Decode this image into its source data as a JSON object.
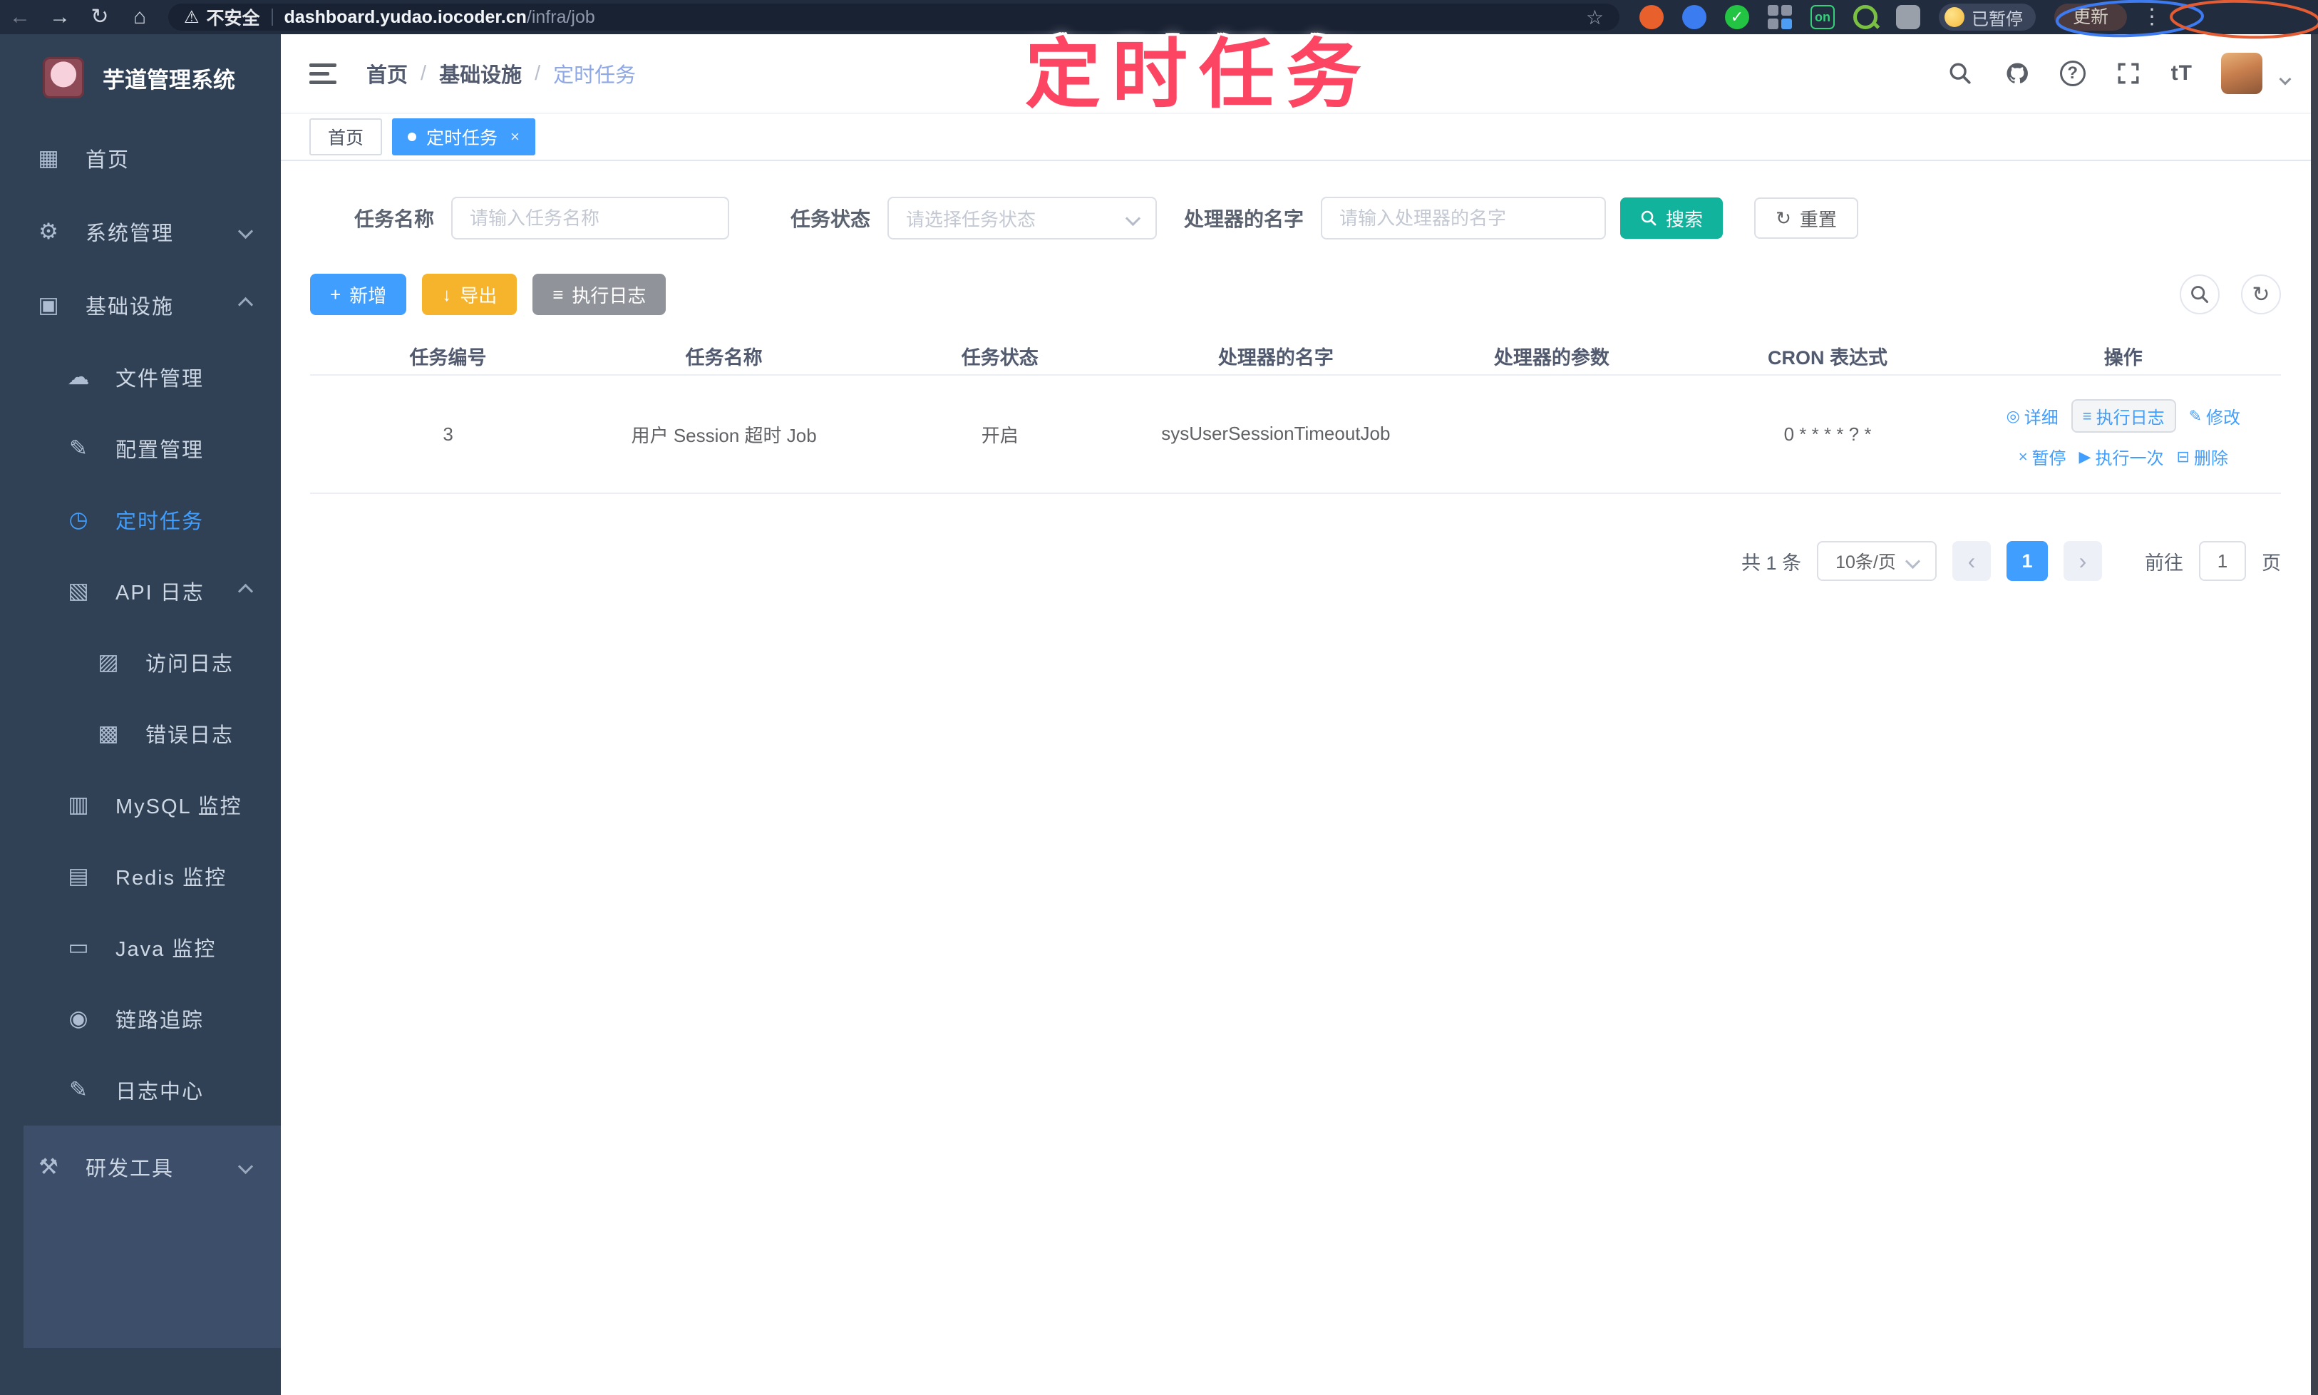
{
  "overlay": {
    "title": "定时任务"
  },
  "browser": {
    "back": "←",
    "forward": "→",
    "reload": "↻",
    "home": "⌂",
    "warn_icon": "⚠",
    "security_label": "不安全",
    "url_domain": "dashboard.yudao.iocoder.cn",
    "url_path": "/infra/job",
    "star": "☆",
    "ext_on_badge": "on",
    "paused_badge": "已暂停",
    "update_label": "更新",
    "menu_dots": "⋮"
  },
  "sidebar": {
    "app_title": "芋道管理系统",
    "items": [
      {
        "label": "首页",
        "glyph": "▦"
      },
      {
        "label": "系统管理",
        "glyph": "⚙"
      },
      {
        "label": "基础设施",
        "glyph": "▣"
      },
      {
        "label": "文件管理",
        "glyph": "☁"
      },
      {
        "label": "配置管理",
        "glyph": "✎"
      },
      {
        "label": "定时任务",
        "glyph": "◷"
      },
      {
        "label": "API 日志",
        "glyph": "▧"
      },
      {
        "label": "访问日志",
        "glyph": "▨"
      },
      {
        "label": "错误日志",
        "glyph": "▩"
      },
      {
        "label": "MySQL 监控",
        "glyph": "▥"
      },
      {
        "label": "Redis 监控",
        "glyph": "▤"
      },
      {
        "label": "Java 监控",
        "glyph": "▭"
      },
      {
        "label": "链路追踪",
        "glyph": "◉"
      },
      {
        "label": "日志中心",
        "glyph": "✎"
      },
      {
        "label": "研发工具",
        "glyph": "⚒"
      }
    ]
  },
  "breadcrumb": {
    "items": [
      "首页",
      "基础设施",
      "定时任务"
    ],
    "separator": "/"
  },
  "header": {
    "font_size_icon": "tT"
  },
  "tabs": [
    {
      "label": "首页"
    },
    {
      "label": "定时任务",
      "close": "×"
    }
  ],
  "filters": {
    "name_label": "任务名称",
    "name_placeholder": "请输入任务名称",
    "status_label": "任务状态",
    "status_placeholder": "请选择任务状态",
    "handler_label": "处理器的名字",
    "handler_placeholder": "请输入处理器的名字",
    "search_label": "搜索",
    "reset_label": "重置",
    "reset_icon": "↻"
  },
  "toolbar": {
    "add_label": "新增",
    "add_icon": "+",
    "export_label": "导出",
    "export_icon": "↓",
    "log_label": "执行日志",
    "log_icon": "≡",
    "refresh_icon": "↻"
  },
  "table": {
    "columns": [
      "任务编号",
      "任务名称",
      "任务状态",
      "处理器的名字",
      "处理器的参数",
      "CRON 表达式",
      "操作"
    ],
    "rows": [
      {
        "id": "3",
        "name": "用户 Session 超时 Job",
        "status": "开启",
        "handler": "sysUserSessionTimeoutJob",
        "param": "",
        "cron": "0 * * * * ? *"
      }
    ],
    "row_actions": [
      {
        "glyph": "◎",
        "label": "详细"
      },
      {
        "glyph": "≡",
        "label": "执行日志"
      },
      {
        "glyph": "✎",
        "label": "修改"
      },
      {
        "glyph": "×",
        "label": "暂停"
      },
      {
        "glyph": "▶",
        "label": "执行一次"
      },
      {
        "glyph": "⊟",
        "label": "删除"
      }
    ]
  },
  "pagination": {
    "total_label": "共 1 条",
    "page_size": "10条/页",
    "prev": "‹",
    "next": "›",
    "current_page": "1",
    "goto_label": "前往",
    "goto_value": "1",
    "page_unit": "页"
  },
  "colors": {
    "accent": "#409EFF",
    "sidebar_bg": "#304156",
    "search_button": "#12b39c",
    "export_button": "#f6b42c",
    "log_button": "#909399",
    "active_tab": "#409EFF",
    "overlay_text": "#fb4563"
  }
}
